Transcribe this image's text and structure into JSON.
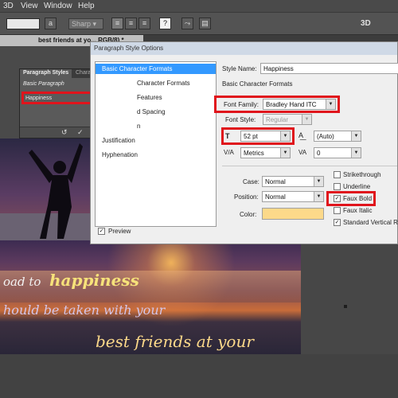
{
  "menubar": {
    "items": [
      "3D",
      "View",
      "Window",
      "Help"
    ]
  },
  "options_bar": {
    "font_size_placeholder": "",
    "antialias": "Sharp",
    "align_left_icon": "align-left-icon",
    "align_center_icon": "align-center-icon",
    "align_right_icon": "align-right-icon",
    "three_d_label": "3D"
  },
  "document_tab": {
    "label": "best friends at yo... RGB/8) *"
  },
  "paragraph_styles_panel": {
    "tab_active": "Paragraph Styles",
    "tab_other": "Characte",
    "items": [
      "Basic Paragraph",
      "Happiness"
    ],
    "selected_index": 1
  },
  "dialog": {
    "title": "Paragraph Style Options",
    "categories": [
      "Basic Character Formats",
      "Advanced Character Formats",
      "OpenType Features",
      "Indents and Spacing",
      "Composition",
      "Justification",
      "Hyphenation"
    ],
    "categories_visible": [
      "Basic Character Formats",
      "Character Formats",
      "Features",
      "d Spacing",
      "n",
      "Justification",
      "Hyphenation"
    ],
    "preview_label": "Preview",
    "preview_checked": true,
    "style_name_label": "Style Name:",
    "style_name_value": "Happiness",
    "section_heading": "Basic Character Formats",
    "font_family_label": "Font Family:",
    "font_family_value": "Bradley Hand ITC",
    "font_style_label": "Font Style:",
    "font_style_value": "Regular",
    "font_size_value": "52 pt",
    "leading_value": "(Auto)",
    "kerning_value": "Metrics",
    "tracking_value": "0",
    "case_label": "Case:",
    "case_value": "Normal",
    "position_label": "Position:",
    "position_value": "Normal",
    "color_label": "Color:",
    "color_value": "#fcd98a",
    "checkboxes": [
      {
        "label": "Strikethrough",
        "checked": false
      },
      {
        "label": "Underline",
        "checked": false
      },
      {
        "label": "Faux Bold",
        "checked": true
      },
      {
        "label": "Faux Italic",
        "checked": false
      },
      {
        "label": "Standard Vertical Ro",
        "checked": true
      }
    ]
  },
  "canvas": {
    "lines": [
      "oad to",
      "happiness",
      "hould be taken with your",
      "best friends at your"
    ],
    "colors": {
      "white": "#f2f2f2",
      "yellow": "#f6e27a",
      "lilac": "#d4c6ea",
      "peach": "#fcd98a"
    }
  },
  "colors": {
    "highlight": "#e0141c",
    "selection": "#3399ff"
  }
}
